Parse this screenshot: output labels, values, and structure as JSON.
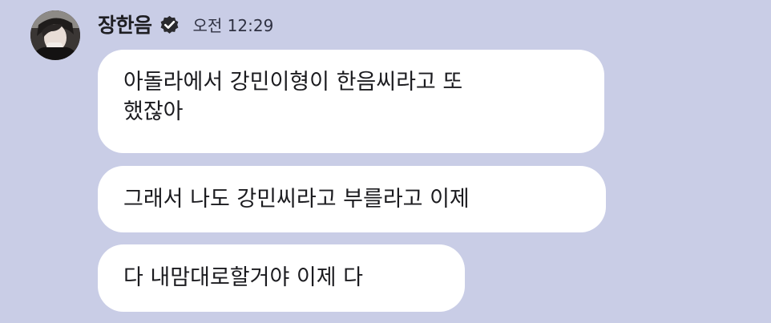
{
  "message_group": {
    "sender": {
      "name": "장한음",
      "verified": true,
      "avatar": "profile-photo"
    },
    "timestamp": "오전 12:29",
    "messages": [
      {
        "lines": [
          "아돌라에서 강민이형이 한음씨라고 또",
          "했잖아"
        ]
      },
      {
        "lines": [
          "그래서 나도 강민씨라고 부를라고 이제"
        ]
      },
      {
        "lines": [
          "다 내맘대로할거야 이제 다"
        ]
      }
    ]
  },
  "colors": {
    "background": "#c9cde6",
    "bubble": "#ffffff",
    "text": "#1b1b1f",
    "verified_badge": "#2a2a2e"
  }
}
